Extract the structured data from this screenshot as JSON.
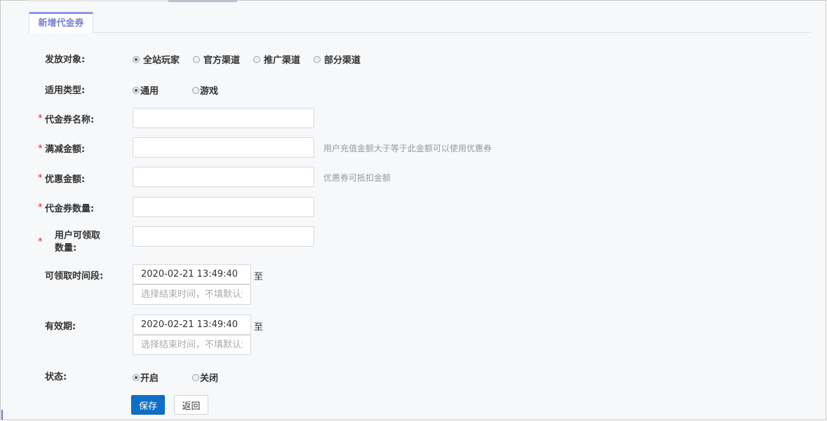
{
  "tab": {
    "label": "新增代金券"
  },
  "form": {
    "target": {
      "label": "发放对象:",
      "options": [
        "全站玩家",
        "官方渠道",
        "推广渠道",
        "部分渠道"
      ],
      "selected": "全站玩家"
    },
    "type": {
      "label": "适用类型:",
      "options": [
        "通用",
        "游戏"
      ],
      "selected": "通用"
    },
    "required_mark": "*",
    "name": {
      "label": "代金券名称:",
      "value": ""
    },
    "threshold": {
      "label": "满减金额:",
      "value": "",
      "hint": "用户充值金额大于等于此金额可以使用优惠券"
    },
    "discount": {
      "label": "优惠金额:",
      "value": "",
      "hint": "优惠券可抵扣金额"
    },
    "quantity": {
      "label": "代金券数量:",
      "value": ""
    },
    "per_user": {
      "label": "用户可领取数量:",
      "value": ""
    },
    "claim_period": {
      "label": "可领取时间段:",
      "start": "2020-02-21 13:49:40",
      "to": "至",
      "end_placeholder": "选择结束时间，不填默认无"
    },
    "validity": {
      "label": "有效期:",
      "start": "2020-02-21 13:49:40",
      "to": "至",
      "end_placeholder": "选择结束时间，不填默认无"
    },
    "status": {
      "label": "状态:",
      "options": [
        "开启",
        "关闭"
      ],
      "selected": "开启"
    }
  },
  "buttons": {
    "save": "保存",
    "back": "返回"
  },
  "colors": {
    "primary": "#0f6fc6",
    "tab_accent": "#8f95e6",
    "required": "#e02020"
  }
}
